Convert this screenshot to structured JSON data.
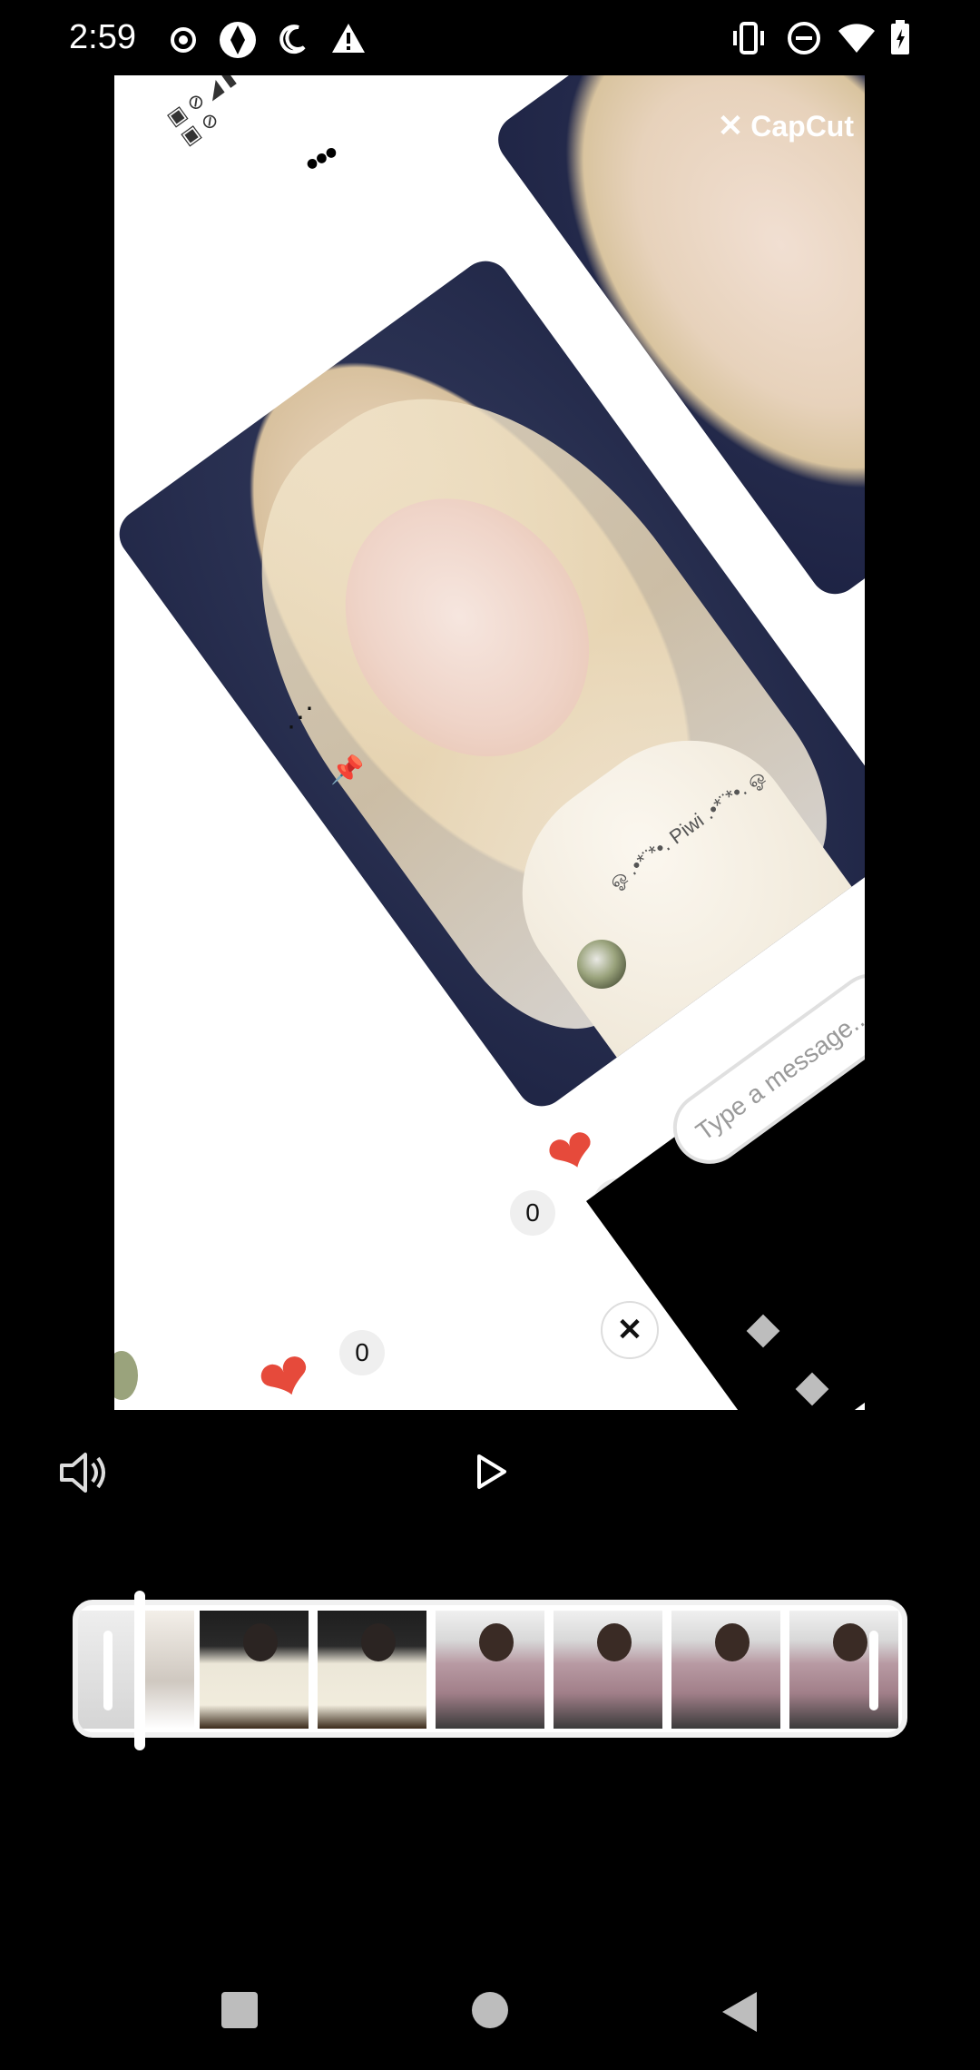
{
  "status_bar": {
    "time": "2:59",
    "left_icons": [
      "record-icon",
      "camera-shutter-icon",
      "night-mode-icon",
      "warning-icon"
    ],
    "right_icons": [
      "vibrate-icon",
      "do-not-disturb-icon",
      "wifi-icon",
      "battery-charging-icon"
    ]
  },
  "preview": {
    "watermark": "CapCut",
    "caption": "ஓ .•*¨*•. Piwi .•*¨*•. ஓ",
    "likes_left": "0",
    "likes_right": "0",
    "message_placeholder": "Type a message..."
  },
  "controls": {
    "volume_icon": "volume-icon",
    "play_icon": "play-icon"
  },
  "timeline": {
    "frames": [
      "post-frame",
      "post-frame",
      "jacket-frame",
      "jacket-frame",
      "pink-jacket-frame",
      "pink-jacket-frame",
      "pink-jacket-frame",
      "pink-jacket-frame"
    ]
  },
  "nav_bar": {
    "icons": [
      "recents-square-icon",
      "home-circle-icon",
      "back-triangle-icon"
    ]
  },
  "colors": {
    "background": "#000000",
    "heart": "#e64a3b",
    "timeline_border": "#f1f1f1"
  }
}
